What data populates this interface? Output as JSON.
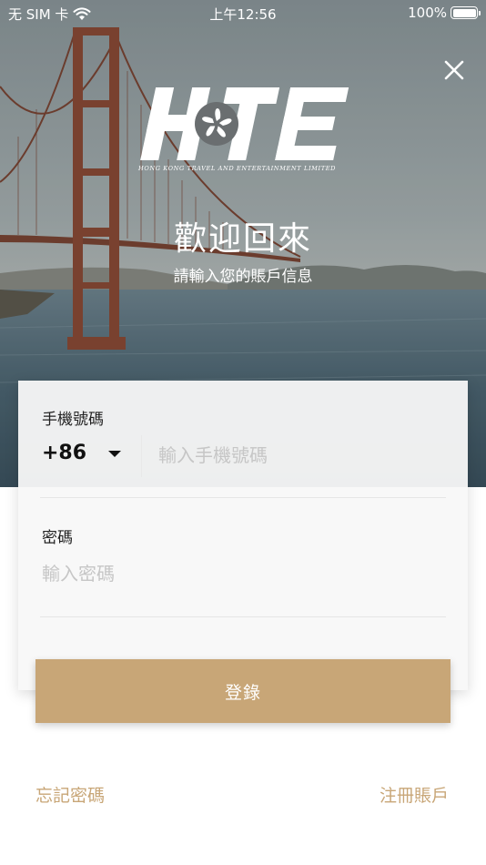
{
  "status_bar": {
    "carrier": "无 SIM 卡",
    "time": "上午12:56",
    "battery": "100%"
  },
  "logo": {
    "wordmark": "HKTE",
    "tagline": "HONG KONG TRAVEL AND ENTERTAINMENT LIMITED"
  },
  "header": {
    "title": "歡迎回來",
    "subtitle": "請輸入您的賬戶信息"
  },
  "form": {
    "phone_label": "手機號碼",
    "country_code": "+86",
    "phone_placeholder": "輸入手機號碼",
    "password_label": "密碼",
    "password_placeholder": "輸入密碼",
    "login_label": "登錄"
  },
  "links": {
    "forgot_password": "忘記密碼",
    "register": "注冊賬戶"
  },
  "colors": {
    "accent": "#c8a677"
  },
  "icons": [
    "wifi-icon",
    "battery-icon",
    "close-icon",
    "bauhinia-icon",
    "dropdown-caret-icon"
  ]
}
